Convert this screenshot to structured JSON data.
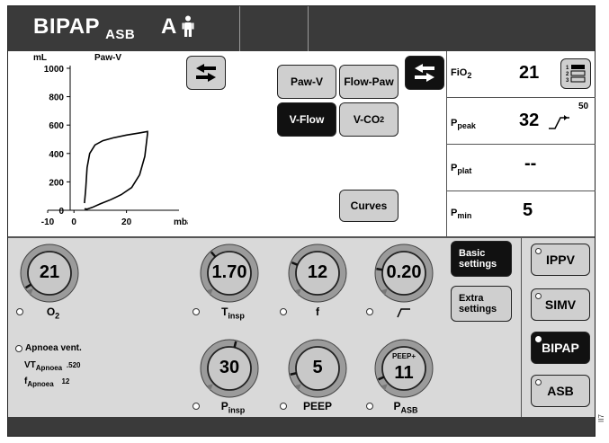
{
  "header": {
    "mode_main": "BIPAP",
    "mode_sub": "ASB",
    "patient_letter": "A",
    "person_icon": "person-icon"
  },
  "loop_chart": {
    "unit_y": "mL",
    "title": "Paw-V",
    "unit_x": "mbar",
    "y_ticks": [
      "1000",
      "800",
      "600",
      "400",
      "200",
      "0"
    ],
    "x_ticks": [
      "-10",
      "0",
      "20"
    ]
  },
  "chart_data": {
    "type": "line",
    "title": "Paw-V",
    "xlabel": "mbar",
    "ylabel": "mL",
    "xlim": [
      -10,
      40
    ],
    "ylim": [
      0,
      1000
    ],
    "grid": false,
    "series": [
      {
        "values_x": [
          4,
          4.5,
          5,
          6,
          8,
          11,
          15,
          20,
          25,
          28,
          28,
          27,
          25,
          22,
          18,
          14,
          10,
          7,
          5,
          4
        ],
        "values_y": [
          50,
          150,
          300,
          400,
          460,
          490,
          510,
          530,
          545,
          555,
          540,
          380,
          250,
          160,
          110,
          75,
          45,
          20,
          8,
          10
        ]
      }
    ]
  },
  "view_buttons": {
    "paw_v": "Paw-V",
    "flow_paw": "Flow-Paw",
    "v_flow": "V-Flow",
    "v_co2_main": "V-CO",
    "v_co2_sub": "2",
    "curves": "Curves"
  },
  "measurements": {
    "fio2": {
      "label_main": "FiO",
      "label_sub": "2",
      "value": "21"
    },
    "ppeak": {
      "label_main": "P",
      "label_sub": "peak",
      "value": "32",
      "limit": "50"
    },
    "pplat": {
      "label_main": "P",
      "label_sub": "plat",
      "value": "--"
    },
    "pmin": {
      "label_main": "P",
      "label_sub": "min",
      "value": "5"
    },
    "list_icon_numbers": [
      "1",
      "2",
      "3"
    ]
  },
  "dials": {
    "o2": {
      "value": "21",
      "label_main": "O",
      "label_sub": "2",
      "level": 0.05
    },
    "tinsp": {
      "value": "1.70",
      "label_main": "T",
      "label_sub": "insp",
      "level": 0.35
    },
    "f": {
      "value": "12",
      "label": "f",
      "level": 0.25
    },
    "ramp": {
      "value": "0.20",
      "level": 0.2
    },
    "pinsp": {
      "value": "30",
      "label_main": "P",
      "label_sub": "insp",
      "level": 0.55
    },
    "peep": {
      "value": "5",
      "label": "PEEP",
      "level": 0.12
    },
    "pasb": {
      "value": "11",
      "top_label": "PEEP+",
      "label_main": "P",
      "label_sub": "ASB",
      "level": 0.08
    }
  },
  "settings_buttons": {
    "basic_line1": "Basic",
    "basic_line2": "settings",
    "extra_line1": "Extra",
    "extra_line2": "settings"
  },
  "apnoea": {
    "title": "Apnoea vent.",
    "vt_main": "VT",
    "vt_sub": "Apnoea",
    "vt_value": ".520",
    "f_main": "f",
    "f_sub": "Apnoea",
    "f_value": "12"
  },
  "modes": {
    "ippv": "IPPV",
    "simv": "SIMV",
    "bipap": "BIPAP",
    "asb": "ASB"
  },
  "side_code": "II7"
}
